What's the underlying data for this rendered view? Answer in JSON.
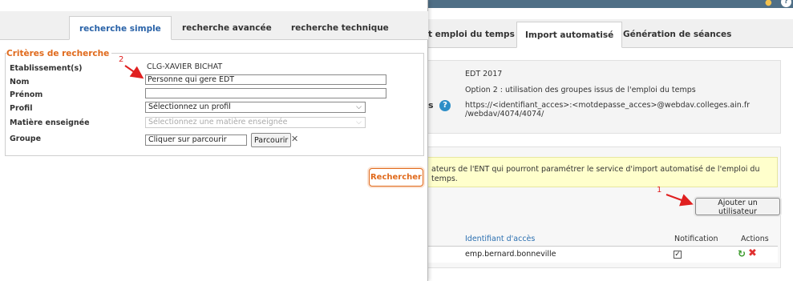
{
  "background": {
    "tabs": [
      {
        "label": "t emploi du temps"
      },
      {
        "label": "Import automatisé"
      },
      {
        "label": "Génération de séances"
      }
    ],
    "config": {
      "line1": "EDT 2017",
      "line2": "Option 2 : utilisation des groupes issus de l'emploi du temps",
      "url_line1": "https://<identifiant_acces>:<motdepasse_acces>@webdav.colleges.ain.fr",
      "url_line2": "/webdav/4074/4074/",
      "label_fragment": "s"
    },
    "users": {
      "notice": "ateurs de l'ENT qui pourront paramétrer le service d'import automatisé de l'emploi du temps.",
      "add_button": "Ajouter un utilisateur",
      "headers": {
        "access_id": "Identifiant d'accès",
        "notification": "Notification",
        "actions": "Actions"
      },
      "rows": [
        {
          "access_id": "emp.bernard.bonneville",
          "notification_checked": "✓"
        }
      ]
    }
  },
  "modal": {
    "tabs": [
      {
        "label": "recherche simple",
        "active": true
      },
      {
        "label": "recherche avancée",
        "active": false
      },
      {
        "label": "recherche technique",
        "active": false
      }
    ],
    "criteria": {
      "legend": "Critères de recherche",
      "establishment": {
        "label": "Etablissement(s)",
        "value": "CLG-XAVIER BICHAT"
      },
      "name": {
        "label": "Nom",
        "value": "Personne qui gere EDT"
      },
      "firstname": {
        "label": "Prénom",
        "value": ""
      },
      "profile": {
        "label": "Profil",
        "selected": "Sélectionnez un profil"
      },
      "subject": {
        "label": "Matière enseignée",
        "selected": "Sélectionnez une matière enseignée"
      },
      "group": {
        "label": "Groupe",
        "value": "Cliquer sur parcourir",
        "browse": "Parcourir",
        "clear": "✕"
      }
    },
    "search_button": "Rechercher"
  },
  "annotations": {
    "n1": "1",
    "n2": "2"
  },
  "colors": {
    "accent_orange": "#e06a1c",
    "tab_blue": "#2a63a8",
    "annotation_red": "#e02020",
    "header_blue": "#4f6f86",
    "notice_yellow": "#ffffcc"
  },
  "icons": {
    "help": "question-circle-icon",
    "edit": "refresh-icon",
    "delete": "delete-x-icon",
    "clear": "close-icon",
    "chevron": "chevron-down-icon"
  }
}
